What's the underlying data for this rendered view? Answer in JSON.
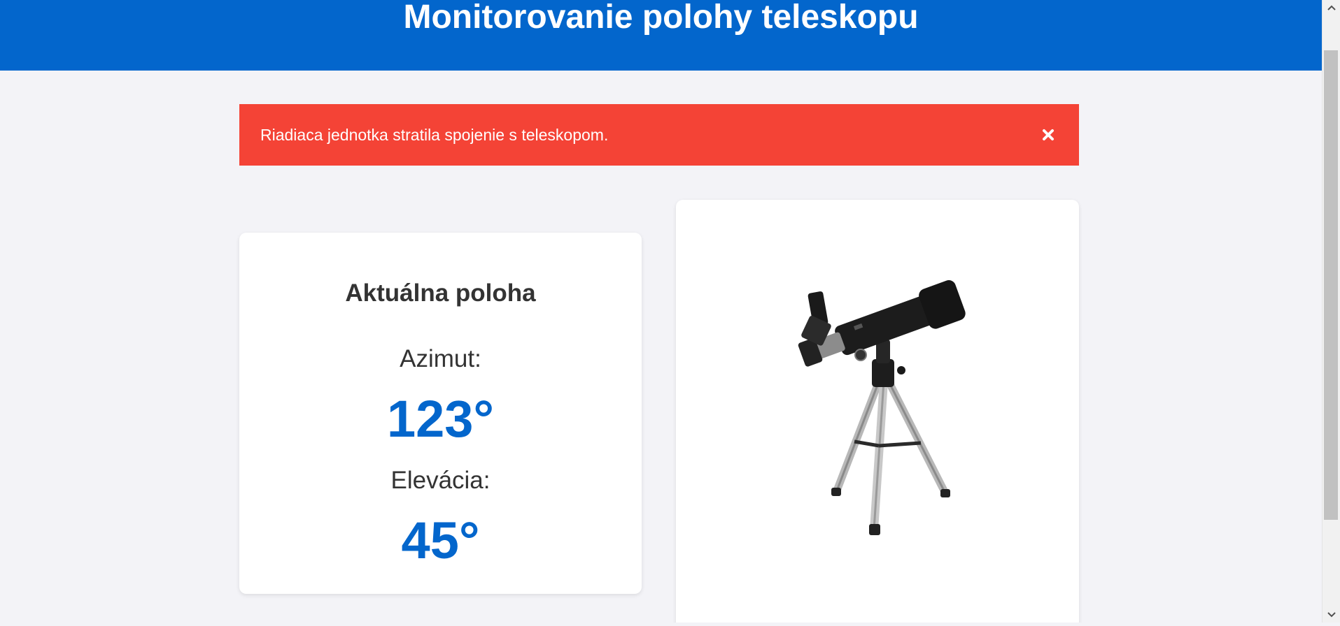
{
  "header": {
    "title": "Monitorovanie polohy teleskopu"
  },
  "alert": {
    "message": "Riadiaca jednotka stratila spojenie s teleskopom.",
    "close_icon": "close-icon",
    "color": "#f44336"
  },
  "position_card": {
    "title": "Aktuálna poloha",
    "azimuth_label": "Azimut:",
    "azimuth_value": "123°",
    "elevation_label": "Elevácia:",
    "elevation_value": "45°"
  },
  "image_card": {
    "image_alt": "telescope-image"
  },
  "colors": {
    "brand_blue": "#0366cc",
    "alert_red": "#f44336",
    "background": "#f3f3f7"
  }
}
